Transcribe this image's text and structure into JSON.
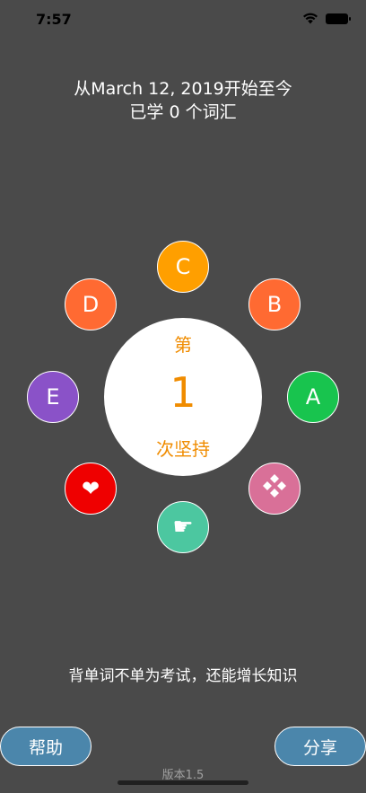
{
  "status_bar": {
    "time": "7:57"
  },
  "header": {
    "line1": "从March 12, 2019开始至今",
    "line2": "已学 0 个词汇"
  },
  "menu": {
    "c": "C",
    "d": "D",
    "b": "B",
    "e": "E",
    "a": "A",
    "heart_icon": "❤",
    "pointing_icon": "☛"
  },
  "streak": {
    "prefix": "第",
    "count": "1",
    "suffix": "次坚持"
  },
  "slogan": "背单词不单为考试，还能增长知识",
  "footer": {
    "help": "帮助",
    "share": "分享",
    "version": "版本1.5"
  },
  "colors": {
    "background": "#4a4a4a",
    "button_c": "#ff9f00",
    "button_d_b": "#ff6a32",
    "button_e": "#8a52c8",
    "button_a": "#18c44e",
    "button_heart": "#ef0000",
    "button_grid": "#d97098",
    "button_point": "#4cc7a0",
    "streak_text": "#f08c00",
    "footer_button": "#4b86ab"
  }
}
